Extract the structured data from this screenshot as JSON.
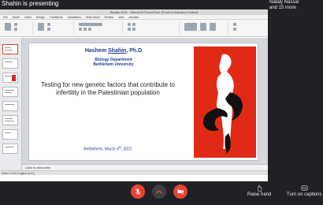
{
  "banner": {
    "presenting_text": "Shahin is presenting"
  },
  "participants": {
    "name": "Nataly Nassar",
    "more": "and 15 more"
  },
  "app": {
    "title": "Biotalk 2021 - Microsoft PowerPoint (Product Activation Failed)",
    "ribbon_tabs": [
      "File",
      "Home",
      "Insert",
      "Design",
      "Transitions",
      "Animations",
      "Slide Show",
      "Review",
      "View",
      "Acrobat"
    ],
    "notes_placeholder": "Click to add notes",
    "status": "Slide 1 of 21   English (U.S.)"
  },
  "slide": {
    "presenter_first": "Hashem ",
    "presenter_last": "Shahin",
    "presenter_suffix": ", Ph.D",
    "department": "Biology Department",
    "university": "Bethlehem University",
    "title": "Testing for new genetic factors that contribute to infertility in the Palestinian population",
    "date_prefix": "Bethlehem, March  4",
    "date_sup": "th",
    "date_suffix": ", 2021"
  },
  "controls": {
    "raise_hand_label": "Raise hand",
    "captions_label": "Turn on captions"
  },
  "colors": {
    "danger": "#ea4335",
    "slide_accent": "#e02a16",
    "title_blue": "#1f3c8c"
  }
}
